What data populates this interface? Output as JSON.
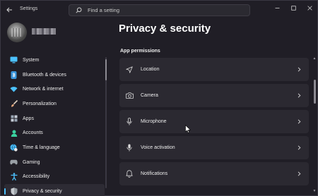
{
  "window": {
    "app_title": "Settings",
    "search_placeholder": "Find a setting",
    "controls": [
      "minimize",
      "maximize",
      "close"
    ]
  },
  "sidebar": {
    "items": [
      {
        "label": "System",
        "icon": "monitor-icon",
        "color": "#4cc2ff"
      },
      {
        "label": "Bluetooth & devices",
        "icon": "bluetooth-icon",
        "color": "#3a96dd"
      },
      {
        "label": "Network & internet",
        "icon": "wifi-icon",
        "color": "#4cc2ff"
      },
      {
        "label": "Personalization",
        "icon": "brush-icon",
        "color": "#e8a87c"
      },
      {
        "label": "Apps",
        "icon": "apps-icon",
        "color": "#9aa6b4"
      },
      {
        "label": "Accounts",
        "icon": "person-icon",
        "color": "#3ad29f"
      },
      {
        "label": "Time & language",
        "icon": "globe-clock-icon",
        "color": "#4cc2ff"
      },
      {
        "label": "Gaming",
        "icon": "gamepad-icon",
        "color": "#9aa0a6"
      },
      {
        "label": "Accessibility",
        "icon": "accessibility-icon",
        "color": "#4cc2ff"
      },
      {
        "label": "Privacy & security",
        "icon": "shield-icon",
        "color": "#9aa0a6",
        "selected": true
      }
    ]
  },
  "main": {
    "title": "Privacy & security",
    "section": "App permissions",
    "permissions": [
      {
        "label": "Location",
        "icon": "location-icon"
      },
      {
        "label": "Camera",
        "icon": "camera-icon"
      },
      {
        "label": "Microphone",
        "icon": "microphone-icon"
      },
      {
        "label": "Voice activation",
        "icon": "voice-activation-icon"
      },
      {
        "label": "Notifications",
        "icon": "bell-icon"
      }
    ]
  },
  "colors": {
    "accent": "#4cc2ff",
    "window_bg": "#201e26",
    "card_bg": "#2b2931"
  }
}
